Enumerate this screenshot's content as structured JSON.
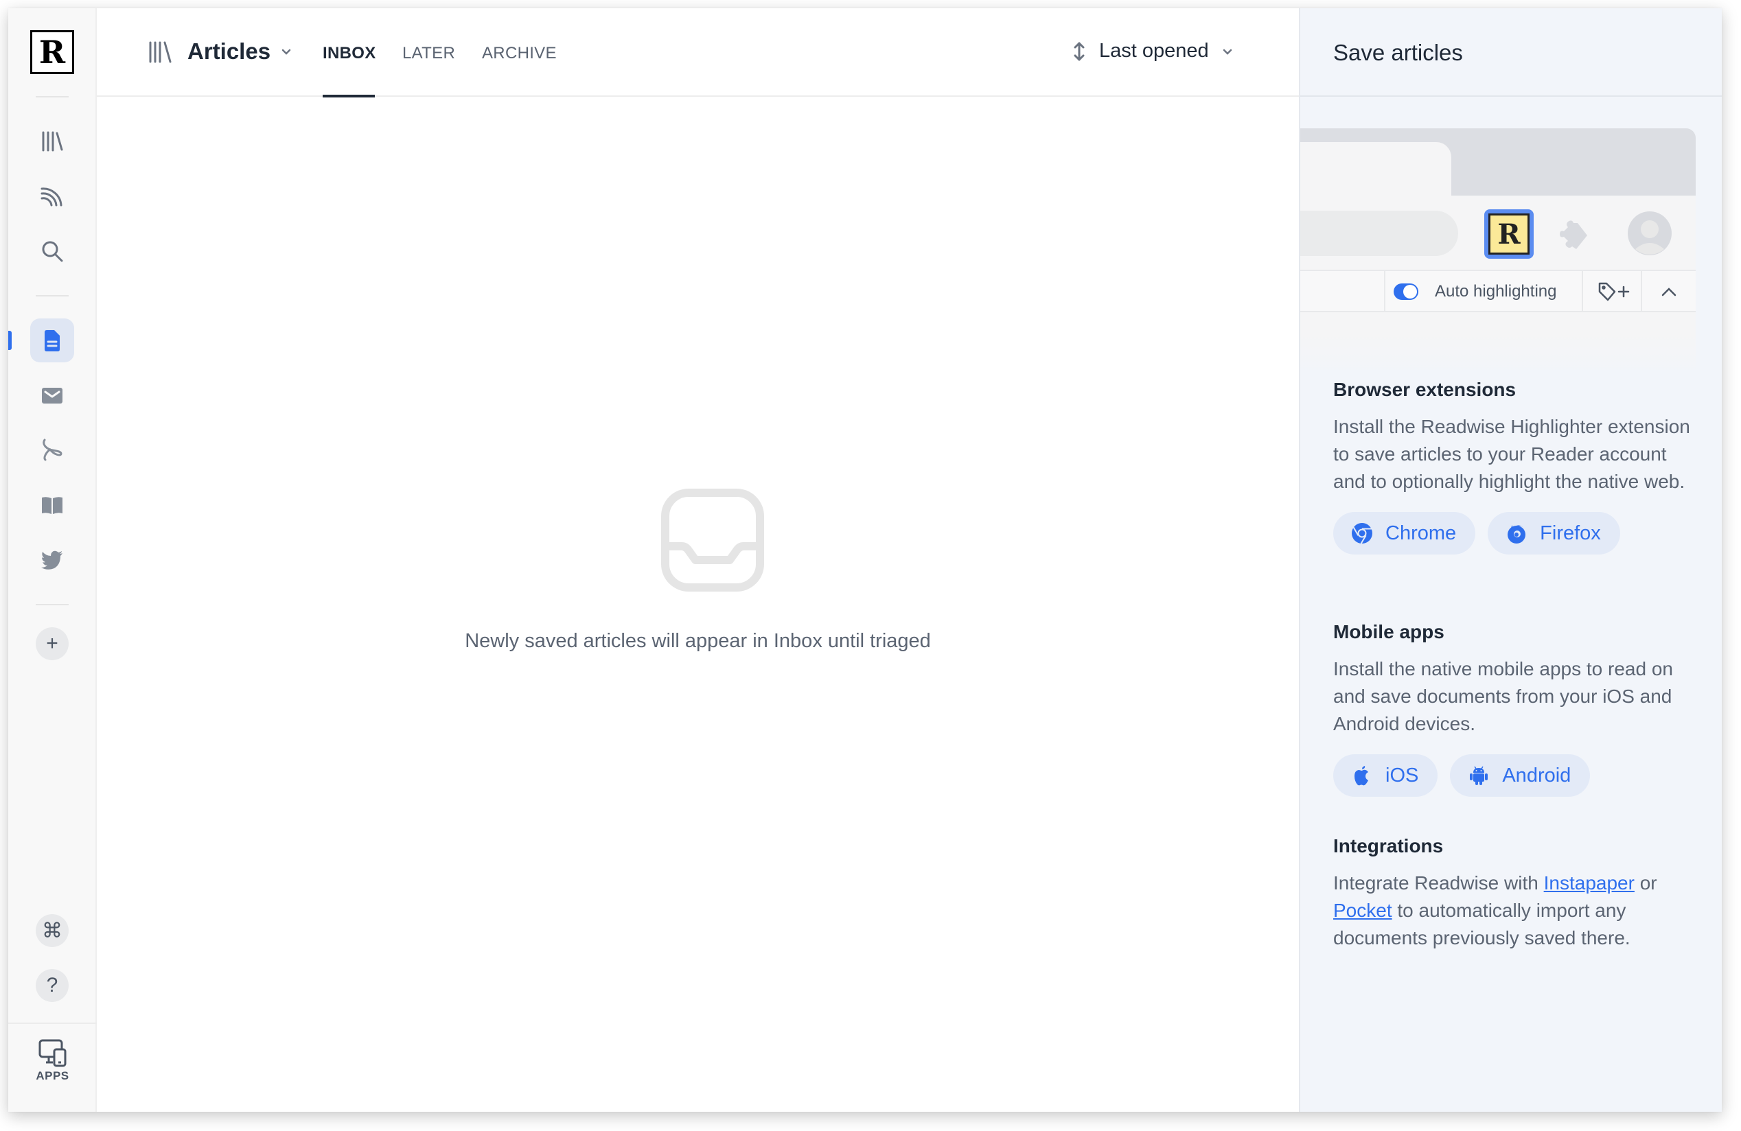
{
  "sidebar": {
    "logo": "R",
    "items": [
      {
        "name": "library",
        "icon": "library-icon"
      },
      {
        "name": "feed",
        "icon": "rss-icon"
      },
      {
        "name": "search",
        "icon": "search-icon"
      },
      {
        "name": "articles",
        "icon": "document-icon",
        "active": true
      },
      {
        "name": "email",
        "icon": "mail-icon"
      },
      {
        "name": "pdf",
        "icon": "pdf-icon"
      },
      {
        "name": "books",
        "icon": "book-icon"
      },
      {
        "name": "twitter",
        "icon": "twitter-icon"
      }
    ],
    "add_label": "+",
    "command_label": "⌘",
    "help_label": "?",
    "apps_label": "APPS"
  },
  "header": {
    "title": "Articles",
    "tabs": [
      {
        "label": "INBOX",
        "active": true
      },
      {
        "label": "LATER",
        "active": false
      },
      {
        "label": "ARCHIVE",
        "active": false
      }
    ],
    "sort_label": "Last opened"
  },
  "main": {
    "empty_message": "Newly saved articles will appear in Inbox until triaged"
  },
  "panel": {
    "title": "Save articles",
    "mockup": {
      "extension_logo": "R",
      "auto_highlighting_label": "Auto highlighting",
      "auto_highlighting_on": true,
      "tag_add_label": "+"
    },
    "browser_extensions": {
      "title": "Browser extensions",
      "body": "Install the Readwise Highlighter extension to save articles to your Reader account and to optionally highlight the native web.",
      "buttons": [
        "Chrome",
        "Firefox"
      ]
    },
    "mobile_apps": {
      "title": "Mobile apps",
      "body": "Install the native mobile apps to read on and save documents from your iOS and Android devices.",
      "buttons": [
        "iOS",
        "Android"
      ]
    },
    "integrations": {
      "title": "Integrations",
      "body_prefix": "Integrate Readwise with ",
      "link1": "Instapaper",
      "body_middle": " or ",
      "link2": "Pocket",
      "body_suffix": " to automatically import any documents previously saved there."
    }
  },
  "colors": {
    "accent": "#2f6fed",
    "sidebar_bg": "#f8f8f8",
    "panel_bg": "#f2f5fa",
    "extension_yellow": "#fbe998"
  }
}
